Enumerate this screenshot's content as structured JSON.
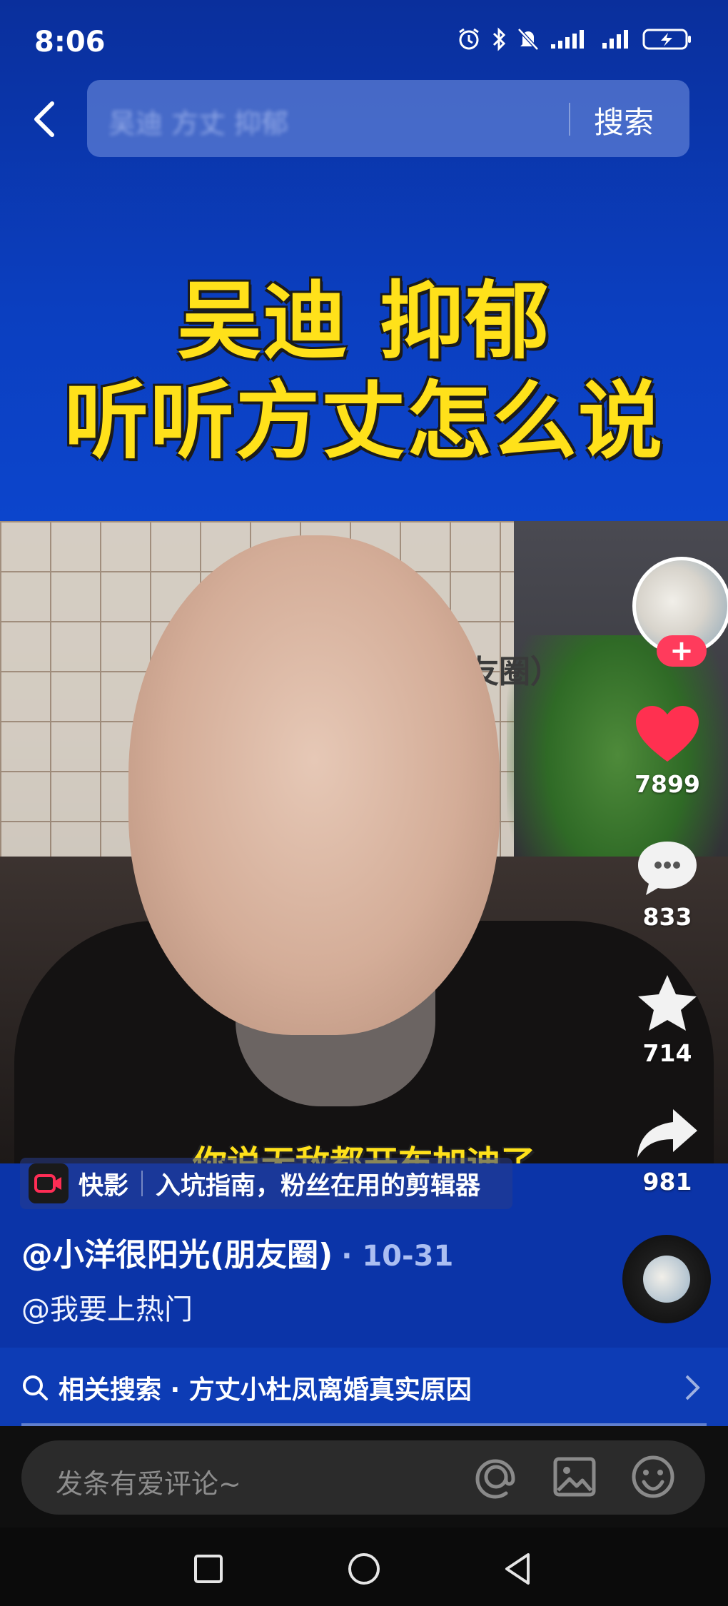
{
  "status_bar": {
    "time": "8:06"
  },
  "search": {
    "query": "吴迪 方丈 抑郁",
    "button_label": "搜索"
  },
  "video": {
    "headline_line1": "吴迪 抑郁",
    "headline_line2": "听听方丈怎么说",
    "subtitle": "你说无敌都开布加迪了",
    "bg_sign_text": "友圈）"
  },
  "actions": {
    "likes": "7899",
    "comments": "833",
    "favorites": "714",
    "shares": "981",
    "follow_glyph": "+"
  },
  "tag": {
    "app_name": "快影",
    "text": "入坑指南，粉丝在用的剪辑器"
  },
  "author": {
    "name": "@小洋很阳光(朋友圈)",
    "date": "· 10-31",
    "mention": "@我要上热门"
  },
  "related": {
    "text": "相关搜索 · 方丈小杜凤离婚真实原因"
  },
  "comment": {
    "placeholder": "发条有爱评论~"
  },
  "colors": {
    "headline": "#ffe11a",
    "follow": "#ff3b5c",
    "like": "#ff3050",
    "bg": "#0b34a8"
  }
}
